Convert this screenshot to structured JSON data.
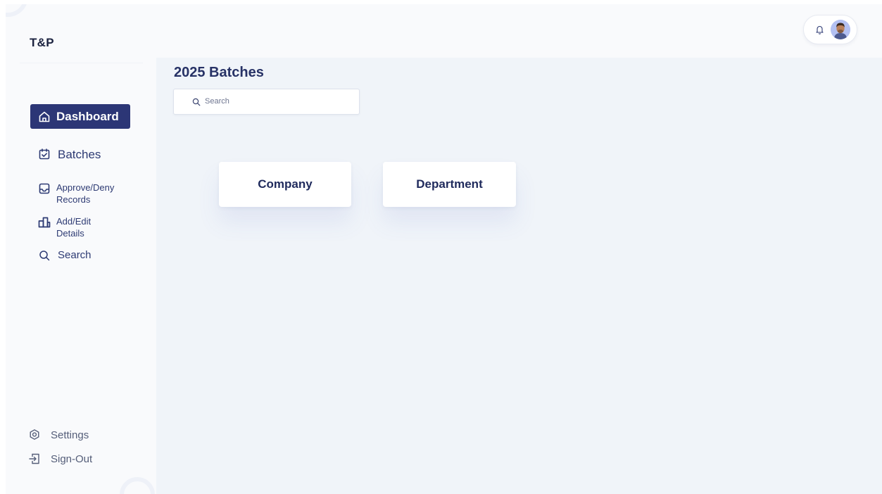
{
  "app": {
    "logo": "T&P"
  },
  "sidebar": {
    "items": [
      {
        "label": "Dashboard",
        "icon": "home-icon",
        "active": true
      },
      {
        "label": "Batches",
        "icon": "calendar-check-icon"
      },
      {
        "label": "Approve/Deny\nRecords",
        "icon": "inbox-icon"
      },
      {
        "label": "Add/Edit\nDetails",
        "icon": "building-icon"
      },
      {
        "label": "Search",
        "icon": "search-icon"
      }
    ],
    "bottom": [
      {
        "label": "Settings",
        "icon": "gear-icon"
      },
      {
        "label": "Sign-Out",
        "icon": "sign-out-icon"
      }
    ]
  },
  "header": {
    "notification_icon": "bell-icon",
    "avatar_icon": "user-avatar"
  },
  "main": {
    "title": "2025 Batches",
    "search": {
      "placeholder": "Search",
      "value": ""
    },
    "cards": [
      {
        "label": "Company"
      },
      {
        "label": "Department"
      }
    ]
  },
  "colors": {
    "accent": "#2c3676",
    "background": "#f0f4f9",
    "sidebar_bg": "#f9fafc",
    "text": "#273266"
  }
}
